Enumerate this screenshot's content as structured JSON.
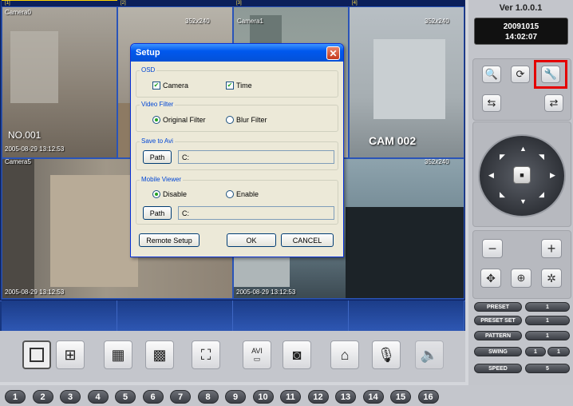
{
  "video": {
    "tabs": [
      "[1]",
      "[2]",
      "[3]",
      "[4]"
    ],
    "cells": [
      {
        "name": "Camera0",
        "res": "352x240",
        "overlay": "NO.001",
        "time": "2005-08-29 13:12:53"
      },
      {
        "name": "",
        "res": "352x240"
      },
      {
        "name": "Camera1",
        "res": "352x240"
      },
      {
        "name": "",
        "res": "352x240"
      },
      {
        "name": "Camera5",
        "time": "2005-08-29 13:12:53"
      },
      {
        "name": "CAM 002",
        "res": "352x240",
        "time": "2005-08-29 13:12:53"
      }
    ]
  },
  "dialog": {
    "title": "Setup",
    "close": "✕",
    "osd": {
      "label": "OSD",
      "camera": "Camera",
      "time": "Time"
    },
    "filter": {
      "label": "Video Filter",
      "original": "Original Filter",
      "blur": "Blur Filter"
    },
    "avi": {
      "label": "Save to Avi",
      "path_button": "Path",
      "path_value": "C:"
    },
    "mobile": {
      "label": "Mobile Viewer",
      "disable": "Disable",
      "enable": "Enable",
      "path_button": "Path",
      "path_value": "C:"
    },
    "remote": "Remote Setup",
    "ok": "OK",
    "cancel": "CANCEL"
  },
  "panel": {
    "version": "Ver 1.0.0.1",
    "date": "20091015",
    "time": "14:02:07",
    "minus": "−",
    "plus": "+",
    "rows": [
      {
        "label": "PRESET",
        "value": "1"
      },
      {
        "label": "PRESET SET",
        "value": "1"
      },
      {
        "label": "PATTERN",
        "value": "1"
      },
      {
        "label": "SWING",
        "value": "1",
        "value2": "1"
      },
      {
        "label": "SPEED",
        "value": "5"
      }
    ]
  },
  "toolbar": {
    "icons": [
      "single-view-icon",
      "quad-view-icon",
      "nine-view-icon",
      "sixteen-view-icon",
      "fullscreen-icon",
      "avi-record-icon",
      "snapshot-icon",
      "alarm-icon",
      "microphone-icon",
      "speaker-icon"
    ],
    "avi_label": "AVI"
  },
  "channels": [
    "1",
    "2",
    "3",
    "4",
    "5",
    "6",
    "7",
    "8",
    "9",
    "10",
    "11",
    "12",
    "13",
    "14",
    "15",
    "16"
  ]
}
